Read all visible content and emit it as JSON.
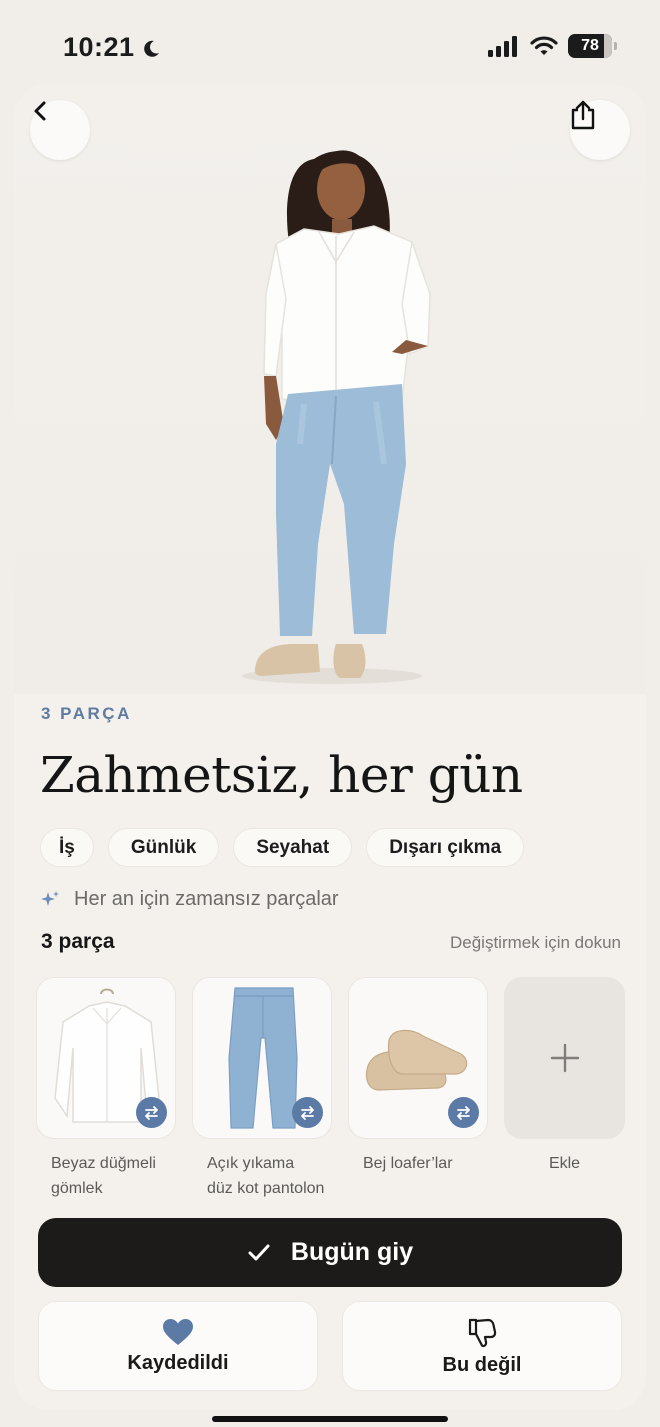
{
  "status": {
    "time": "10:21",
    "battery": "78"
  },
  "outfit": {
    "count_label": "3 PARÇA",
    "title": "Zahmetsiz, her gün",
    "tags": [
      "İş",
      "Günlük",
      "Seyahat",
      "Dışarı çıkma"
    ],
    "hint": "Her an için zamansız parçalar"
  },
  "pieces": {
    "title": "3 parça",
    "tip": "Değiştirmek için dokun",
    "items": [
      {
        "label_line1": "Beyaz düğmeli",
        "label_line2": "gömlek"
      },
      {
        "label_line1": "Açık yıkama",
        "label_line2": "düz kot pantolon"
      },
      {
        "label_line1": "Bej loafer’lar",
        "label_line2": ""
      }
    ],
    "add_label": "Ekle"
  },
  "buttons": {
    "wear_today": "Bugün giy",
    "saved": "Kaydedildi",
    "not_this": "Bu değil"
  },
  "colors": {
    "accent_blue": "#5b7aa6",
    "primary_dark": "#1c1b1a",
    "background": "#f1eeea"
  }
}
